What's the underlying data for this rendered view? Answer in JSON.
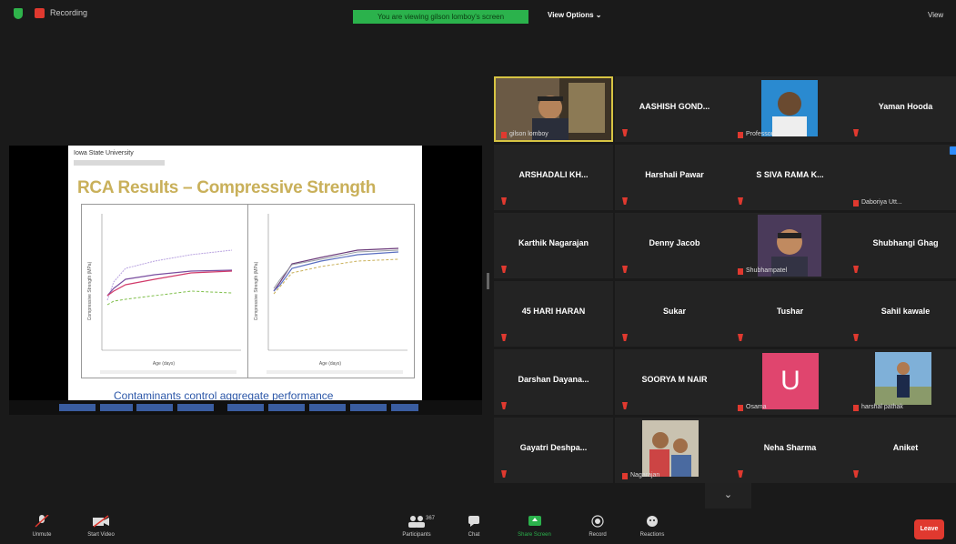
{
  "topbar": {
    "recording_label": "Recording",
    "viewing_banner": "You are viewing gilson lomboy's screen",
    "view_options": "View Options ⌄",
    "view_toggle": "View"
  },
  "slide": {
    "logo_text": "Iowa State University",
    "title": "RCA Results – Compressive Strength",
    "footer": "Contaminants control aggregate performance",
    "left_chart": {
      "xlabel": "Age (days)",
      "ylabel": "Compressive Strength (MPa)",
      "series_colors": [
        "#9b7bd0",
        "#7a4ea0",
        "#d13b6a",
        "#7fbf4a"
      ]
    },
    "right_chart": {
      "xlabel": "Age (days)",
      "ylabel": "Compressive Strength (MPa)",
      "series_colors": [
        "#9aa0a6",
        "#5a6fc0",
        "#6b3a7a",
        "#c9b05a"
      ]
    }
  },
  "gallery": {
    "tiles": [
      {
        "name": "gilson lomboy",
        "type": "video"
      },
      {
        "name": "AASHISH GOND..."
      },
      {
        "name": "Professor",
        "type": "photo"
      },
      {
        "name": "Yaman Hooda"
      },
      {
        "name": "ARSHADALI KH..."
      },
      {
        "name": "Harshali Pawar"
      },
      {
        "name": "S SIVA RAMA K..."
      },
      {
        "name": "Daboriya Utt..."
      },
      {
        "name": "Karthik Nagarajan"
      },
      {
        "name": "Denny Jacob"
      },
      {
        "name": "Shubhampatel",
        "type": "photo"
      },
      {
        "name": "Shubhangi Ghag"
      },
      {
        "name": "45 HARI HARAN"
      },
      {
        "name": "Sukar"
      },
      {
        "name": "Tushar"
      },
      {
        "name": "Sahil kawale"
      },
      {
        "name": "Darshan Dayana..."
      },
      {
        "name": "SOORYA M NAIR"
      },
      {
        "name": "Osama",
        "avatar_letter": "U",
        "type": "avatar"
      },
      {
        "name": "harshal pathak",
        "type": "photo"
      },
      {
        "name": "Gayatri Deshpa..."
      },
      {
        "name": "Nagarajan",
        "type": "photo"
      },
      {
        "name": "Neha Sharma"
      },
      {
        "name": "Aniket"
      }
    ]
  },
  "bottombar": {
    "unmute": "Unmute",
    "start_video": "Start Video",
    "participants": "Participants",
    "participants_count": "367",
    "chat": "Chat",
    "share_screen": "Share Screen",
    "record": "Record",
    "reactions": "Reactions",
    "leave": "Leave"
  }
}
